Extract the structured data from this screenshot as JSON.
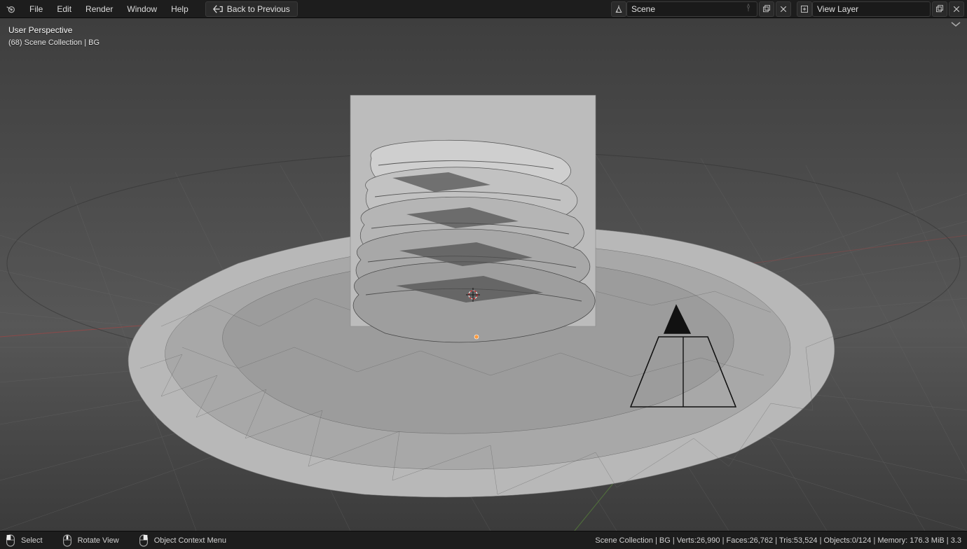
{
  "menu": {
    "file": "File",
    "edit": "Edit",
    "render": "Render",
    "window": "Window",
    "help": "Help",
    "back_to_previous": "Back to Previous"
  },
  "header": {
    "scene_label": "Scene",
    "view_layer_label": "View Layer"
  },
  "viewport": {
    "perspective": "User Perspective",
    "breadcrumb": "(68) Scene Collection | BG"
  },
  "statusbar": {
    "select": "Select",
    "rotate_view": "Rotate View",
    "context_menu": "Object Context Menu",
    "stats": "Scene Collection | BG | Verts:26,990 | Faces:26,762 | Tris:53,524 | Objects:0/124 | Memory: 176.3 MiB | 3.3"
  }
}
